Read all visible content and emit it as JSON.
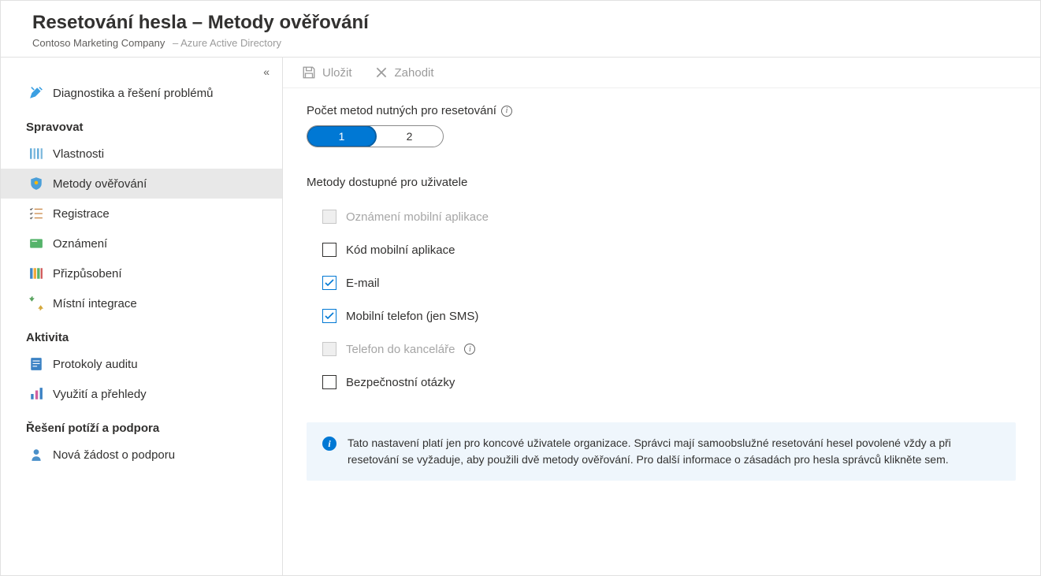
{
  "header": {
    "title": "Resetování hesla – Metody ověřování",
    "company": "Contoso Marketing Company",
    "product": "– Azure Active Directory"
  },
  "toolbar": {
    "save": "Uložit",
    "discard": "Zahodit"
  },
  "sidebar": {
    "diagnose": "Diagnostika a řešení problémů",
    "section_manage": "Spravovat",
    "properties": "Vlastnosti",
    "auth_methods": "Metody ověřování",
    "registration": "Registrace",
    "notifications": "Oznámení",
    "customization": "Přizpůsobení",
    "onprem": "Místní integrace",
    "section_activity": "Aktivita",
    "audit": "Protokoly auditu",
    "usage": "Využití a přehledy",
    "section_trouble": "Řešení potíží a podpora",
    "support": "Nová žádost o podporu"
  },
  "content": {
    "methods_required_label": "Počet metod nutných pro resetování",
    "toggle": {
      "opt1": "1",
      "opt2": "2",
      "selected": "1"
    },
    "available_label": "Metody dostupné pro uživatele",
    "methods": {
      "mobile_app_notification": "Oznámení mobilní aplikace",
      "mobile_app_code": "Kód mobilní aplikace",
      "email": "E-mail",
      "mobile_phone": "Mobilní telefon (jen SMS)",
      "office_phone": "Telefon do kanceláře",
      "security_questions": "Bezpečnostní otázky"
    },
    "info_text": "Tato nastavení platí jen pro koncové uživatele organizace. Správci mají samoobslužné resetování hesel povolené vždy a při resetování se vyžaduje, aby použili dvě metody ověřování. Pro další informace o zásadách pro hesla správců klikněte sem."
  }
}
